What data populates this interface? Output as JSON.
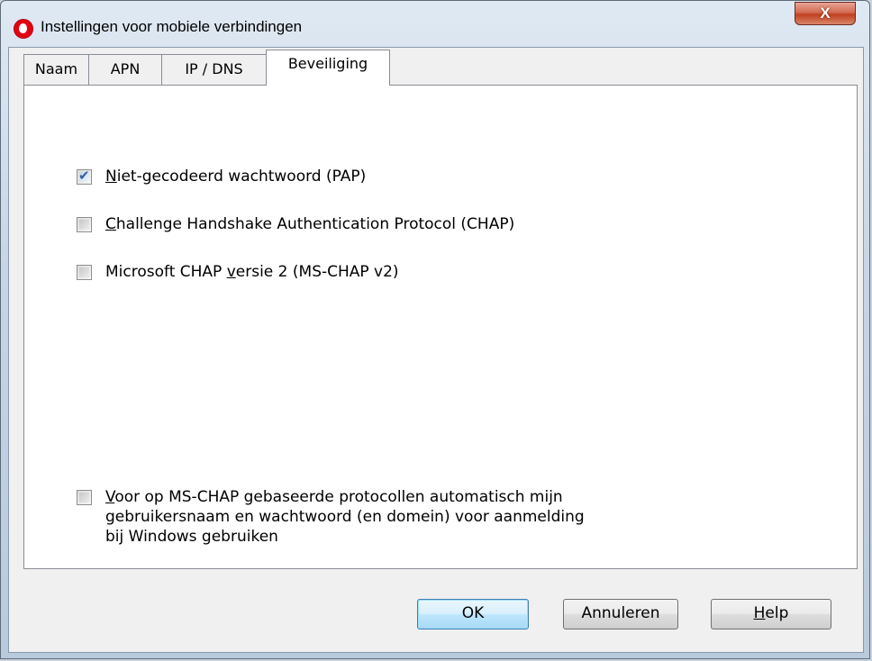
{
  "window": {
    "title": "Instellingen voor mobiele verbindingen",
    "close_label": "X"
  },
  "tabs": [
    {
      "label": "Naam"
    },
    {
      "label": "APN"
    },
    {
      "label": "IP / DNS"
    },
    {
      "label": "Beveiliging",
      "active": true
    }
  ],
  "security": {
    "pap": {
      "access_key": "N",
      "rest": "iet-gecodeerd wachtwoord (PAP)",
      "checked": true
    },
    "chap": {
      "access_key": "C",
      "rest": "hallenge Handshake Authentication Protocol (CHAP)",
      "checked": false
    },
    "mschap": {
      "before": "Microsoft CHAP ",
      "access_key": "v",
      "rest": "ersie 2 (MS-CHAP v2)",
      "checked": false
    },
    "auto_login": {
      "access_key": "V",
      "line1_rest": "oor op MS-CHAP gebaseerde protocollen automatisch mijn",
      "line2": "gebruikersnaam en wachtwoord (en domein) voor aanmelding",
      "line3": "bij Windows gebruiken",
      "checked": false
    }
  },
  "buttons": {
    "ok": "OK",
    "cancel": "Annuleren",
    "help_key": "H",
    "help_rest": "elp"
  },
  "icons": {
    "app": "vodafone-logo-icon",
    "close": "close-icon",
    "check": "checkmark-icon"
  },
  "colors": {
    "accent": "#3c7fb1",
    "close": "#c0401f",
    "brand": "#e40011"
  }
}
